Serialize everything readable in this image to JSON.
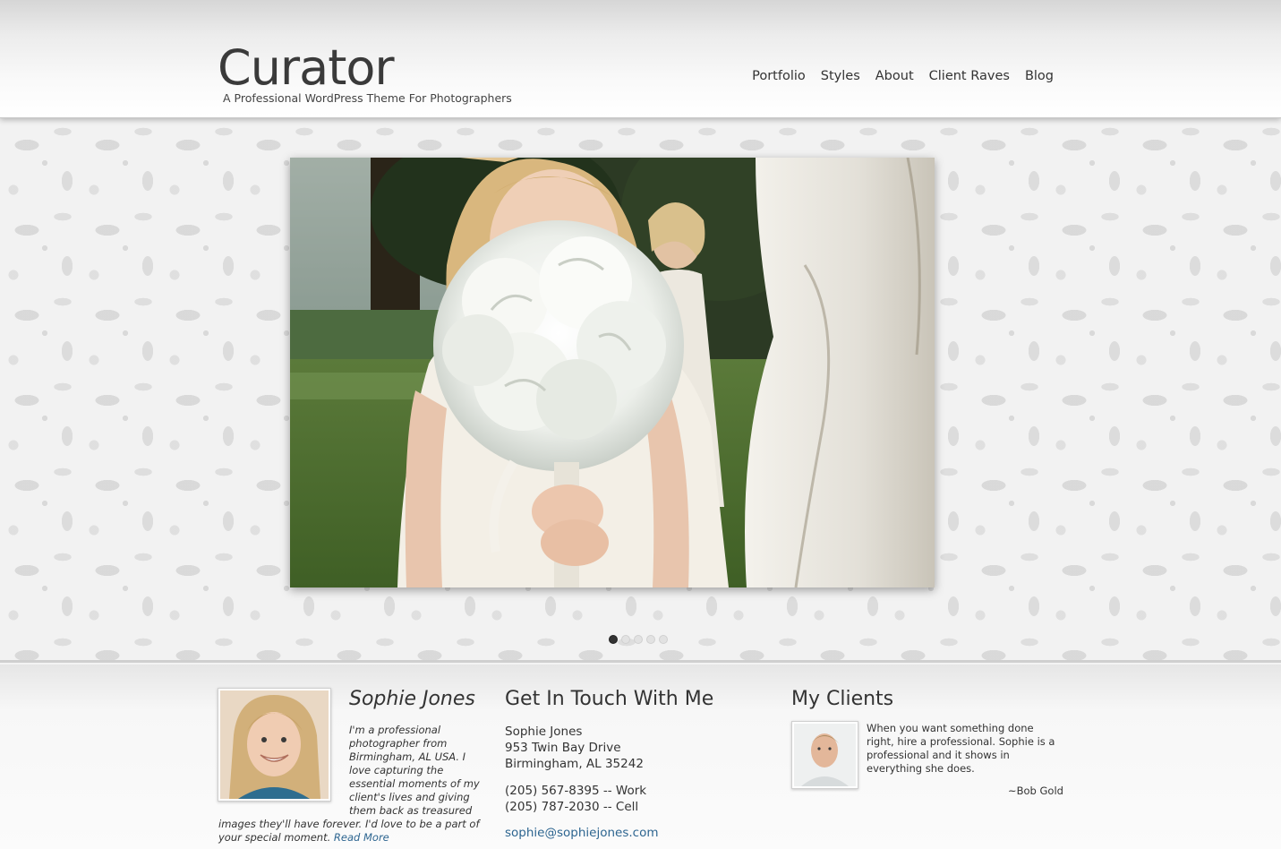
{
  "header": {
    "site_title": "Curator",
    "tagline": "A Professional WordPress Theme For Photographers",
    "nav": [
      {
        "label": "Portfolio"
      },
      {
        "label": "Styles"
      },
      {
        "label": "About"
      },
      {
        "label": "Client Raves"
      },
      {
        "label": "Blog"
      }
    ]
  },
  "slideshow": {
    "image_icon": "flower-girl-photo",
    "slide_count": 5,
    "active_slide": 1
  },
  "bio": {
    "name": "Sophie Jones",
    "text": "I'm a professional photographer from Birmingham, AL USA. I love capturing the essential moments of my client's lives and giving them back as treasured images they'll have forever. I'd love to be a part of your special moment.",
    "read_more": "Read More"
  },
  "contact": {
    "title": "Get In Touch With Me",
    "name": "Sophie Jones",
    "street": "953 Twin Bay Drive",
    "city": "Birmingham, AL 35242",
    "phone_work": "(205) 567-8395 -- Work",
    "phone_cell": "(205) 787-2030 -- Cell",
    "email": "sophie@sophiejones.com"
  },
  "clients": {
    "title": "My Clients",
    "quote": "When you want something done right, hire a professional.  Sophie is a professional and it shows in everything she does.",
    "author": "~Bob Gold"
  },
  "colors": {
    "link": "#2d6590",
    "text": "#333333",
    "active_dot": "#333333"
  }
}
